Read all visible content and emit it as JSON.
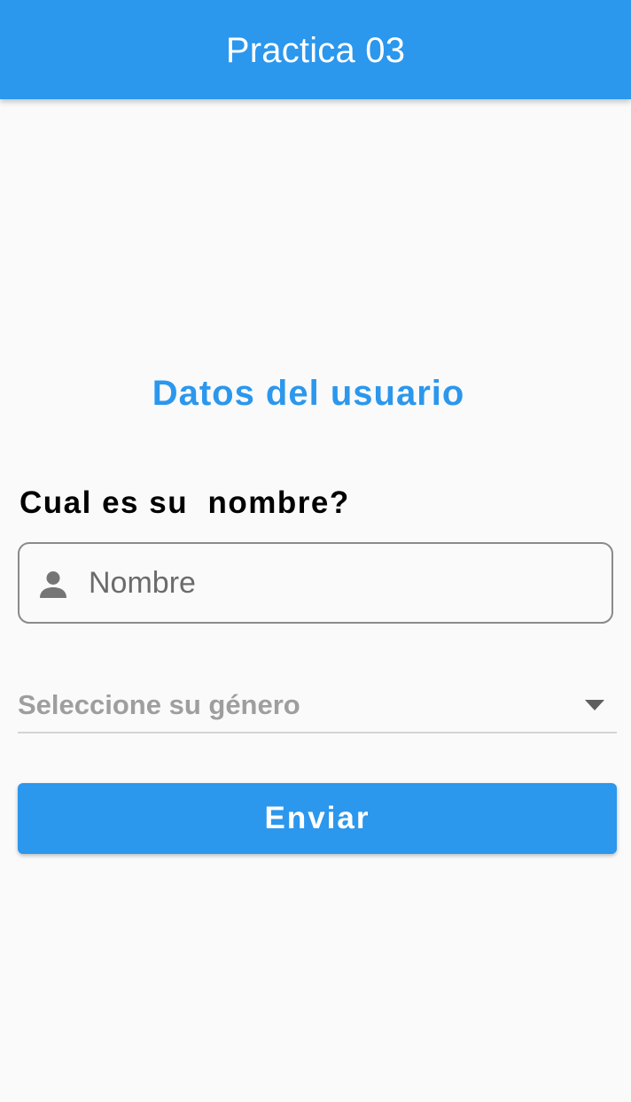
{
  "app_bar": {
    "title": "Practica 03",
    "color": "#2b97ed"
  },
  "form": {
    "section_title": "Datos del usuario",
    "question": "Cual es su  nombre?",
    "name_field": {
      "placeholder": "Nombre",
      "value": "",
      "icon": "person-icon"
    },
    "gender_dropdown": {
      "hint": "Seleccione su género",
      "icon": "arrow-drop-down-icon"
    },
    "submit_label": "Enviar"
  }
}
